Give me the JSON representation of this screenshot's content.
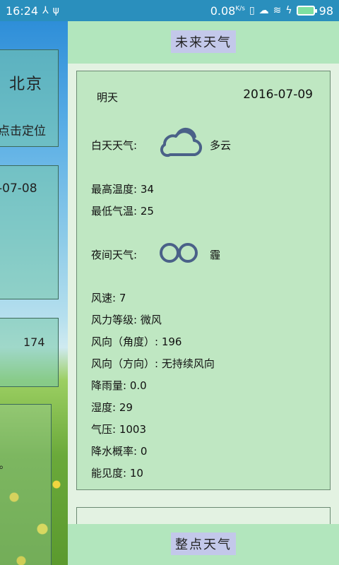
{
  "status_bar": {
    "time": "16:24",
    "speed": "0.08",
    "speed_unit": "K/s",
    "battery": "98",
    "icons": [
      "usb-debug-icon",
      "usb-icon",
      "vibrate-icon",
      "weather-icon",
      "signal-icon",
      "charging-icon",
      "battery-icon"
    ]
  },
  "background": {
    "city": "北京",
    "locate_label": "点击定位",
    "date_fragment": "-07-08",
    "number": "174",
    "mark": "。"
  },
  "drawer": {
    "top_button": "未来天气",
    "bottom_button": "整点天气",
    "forecast": {
      "day": "明天",
      "date": "2016-07-09",
      "day_weather_label": "白天天气:",
      "day_weather_icon": "cloudy-icon",
      "day_weather": "多云",
      "high_temp": "最高温度: 34",
      "low_temp": "最低气温: 25",
      "night_weather_label": "夜间天气:",
      "night_weather_icon": "haze-icon",
      "night_weather": "霾",
      "wind_speed": "风速: 7",
      "wind_level": "风力等级: 微风",
      "wind_dir_deg": "风向（角度）: 196",
      "wind_dir": "风向（方向）: 无持续风向",
      "rainfall": "降雨量: 0.0",
      "humidity": "湿度: 29",
      "pressure": "气压: 1003",
      "precip_prob": "降水概率: 0",
      "visibility": "能见度: 10"
    }
  },
  "colors": {
    "status_bar": "#2a8fbd",
    "drawer_bar": "#b2e6bd",
    "card": "#bfe7c2",
    "button": "#c3c8ea",
    "icon_stroke": "#4a6188"
  }
}
